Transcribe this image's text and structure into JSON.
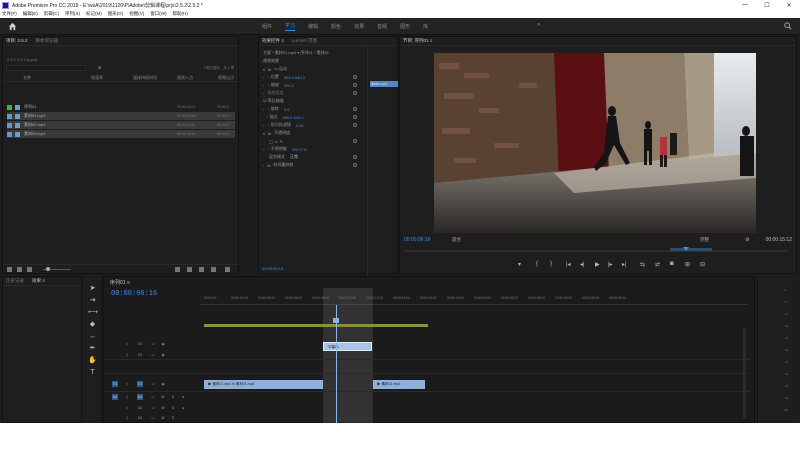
{
  "window": {
    "title": "Adobe Premiere Pro CC 2019 - E:\\wsA\\2019\\1120\\P\\Adobe\\剪辑课程\\prjs\\2.5.2\\2.5.2 *",
    "controls": [
      "—",
      "☐",
      "✕"
    ]
  },
  "menu": [
    "文件(F)",
    "编辑(E)",
    "剪辑(C)",
    "序列(S)",
    "标记(M)",
    "图形(G)",
    "视图(V)",
    "窗口(W)",
    "帮助(H)"
  ],
  "workspaces": {
    "tabs": [
      "组件",
      "学习",
      "编辑",
      "颜色",
      "效果",
      "音频",
      "图形",
      "库"
    ],
    "active_index": 1,
    "more": "»"
  },
  "project_panel": {
    "tabs": [
      "项目: 2.5.2",
      "媒体浏览器"
    ],
    "path": "2.5.2.2.5.2.prproj",
    "search_placeholder": "",
    "search_btn": "⊠",
    "count": "1项已选择，共 4 项",
    "columns": [
      "名称",
      "帧速率",
      "媒体持续时间",
      "视频入点",
      "视频出点"
    ],
    "items": [
      {
        "name": "序列01",
        "dur": "00:00:15:02",
        "fps": "00:00:0",
        "color": "#3bb54a",
        "selected": false
      },
      {
        "name": "素材01.mp4",
        "dur": "00:00:12:00",
        "fps": "00:00:0",
        "color": "#5b9bd5",
        "selected": true
      },
      {
        "name": "素材02.mp4",
        "dur": "00:00:10:11",
        "fps": "00:00:0",
        "color": "#5b9bd5",
        "selected": true
      },
      {
        "name": "素材03.mp4",
        "dur": "00:00:05:14",
        "fps": "00:00:0",
        "color": "#5b9bd5",
        "selected": true
      }
    ]
  },
  "effect_controls": {
    "tabs": [
      "效果控件 ≡",
      "Lumetri 范围",
      "源: 素材01.mp4",
      "音频剪辑混合器: 序列01"
    ],
    "source_line": "主要 * 素材01.mp4 ▾  序列01 * 素材01",
    "clip_label": "素材01.mp4",
    "rows": [
      {
        "tw": "",
        "fx": "",
        "label": "视频效果",
        "val": ""
      },
      {
        "tw": "▾",
        "fx": "fx",
        "label": "▭ 运动",
        "val": ""
      },
      {
        "tw": "›",
        "fx": "",
        "label": "◌ 位置",
        "val": "960.0   540.0"
      },
      {
        "tw": "›",
        "fx": "",
        "label": "◌ 缩放",
        "val": "100.0"
      },
      {
        "tw": "›",
        "fx": "",
        "label": "缩放宽度",
        "val": ""
      },
      {
        "tw": "",
        "fx": "",
        "label": "☑ 等比缩放",
        "val": ""
      },
      {
        "tw": "›",
        "fx": "",
        "label": "◌ 旋转",
        "val": "0.0"
      },
      {
        "tw": "",
        "fx": "",
        "label": "◌ 锚点",
        "val": "960.0   540.0"
      },
      {
        "tw": "›",
        "fx": "",
        "label": "◌ 防闪烁滤镜",
        "val": "0.00"
      },
      {
        "tw": "▾",
        "fx": "fx",
        "label": "不透明度",
        "val": ""
      },
      {
        "tw": "",
        "fx": "",
        "label": "◯ ▭ ✎",
        "val": ""
      },
      {
        "tw": "›",
        "fx": "",
        "label": "◌ 不透明度",
        "val": "100.0 %"
      },
      {
        "tw": "",
        "fx": "",
        "label": "混合模式",
        "val": "正常"
      },
      {
        "tw": "›",
        "fx": "fx",
        "label": "时间重映射",
        "val": ""
      }
    ],
    "timecode": "00:00:06:16"
  },
  "program_monitor": {
    "tab": "节目: 序列01 ≡",
    "current_tc": "00:00:06:16",
    "fit": "适合",
    "quality": "完整",
    "duration_tc": "00:00:15:12",
    "transport": [
      "▾",
      "{",
      "}",
      "|◂",
      "◂|",
      "▶",
      "|▸",
      "▸|",
      "⇆",
      "⇄",
      "◙",
      "⊞",
      "⊟"
    ]
  },
  "timeline": {
    "tab": "序列01 ≡",
    "timecode": "00:00:06:16",
    "ruler": [
      "00:00:00",
      "00:00:02:00",
      "00:00:04:00",
      "00:00:06:00",
      "00:00:08:00",
      "00:00:10:00",
      "00:00:12:00",
      "00:00:14:00",
      "00:00:16:00",
      "00:00:18:00",
      "00:00:20:00",
      "00:00:22:00",
      "00:00:24:00",
      "00:00:26:00",
      "00:00:28:00",
      "00:00:30:00"
    ],
    "tracks": [
      {
        "name": "V3"
      },
      {
        "name": "V2"
      },
      {
        "name": "V1"
      },
      {
        "name": "A1"
      },
      {
        "name": "A2"
      },
      {
        "name": "A3"
      },
      {
        "name": "主声道"
      }
    ],
    "clips": [
      {
        "label": "字幕01",
        "track": "V2",
        "type": "title"
      },
      {
        "label": "▶ 素材01.mp4  fx 素材01.mp4",
        "track": "V1",
        "type": "v1"
      },
      {
        "label": "▶ 素材02.mp4",
        "track": "V1",
        "type": "v1"
      }
    ]
  },
  "left_bottom": {
    "tabs": [
      "历史记录",
      "效果 ≡"
    ]
  },
  "meter": {
    "marks": [
      "0",
      "-6",
      "-12",
      "-18",
      "-24",
      "-30",
      "-36",
      "-42",
      "-48",
      "-54",
      "dB"
    ]
  }
}
